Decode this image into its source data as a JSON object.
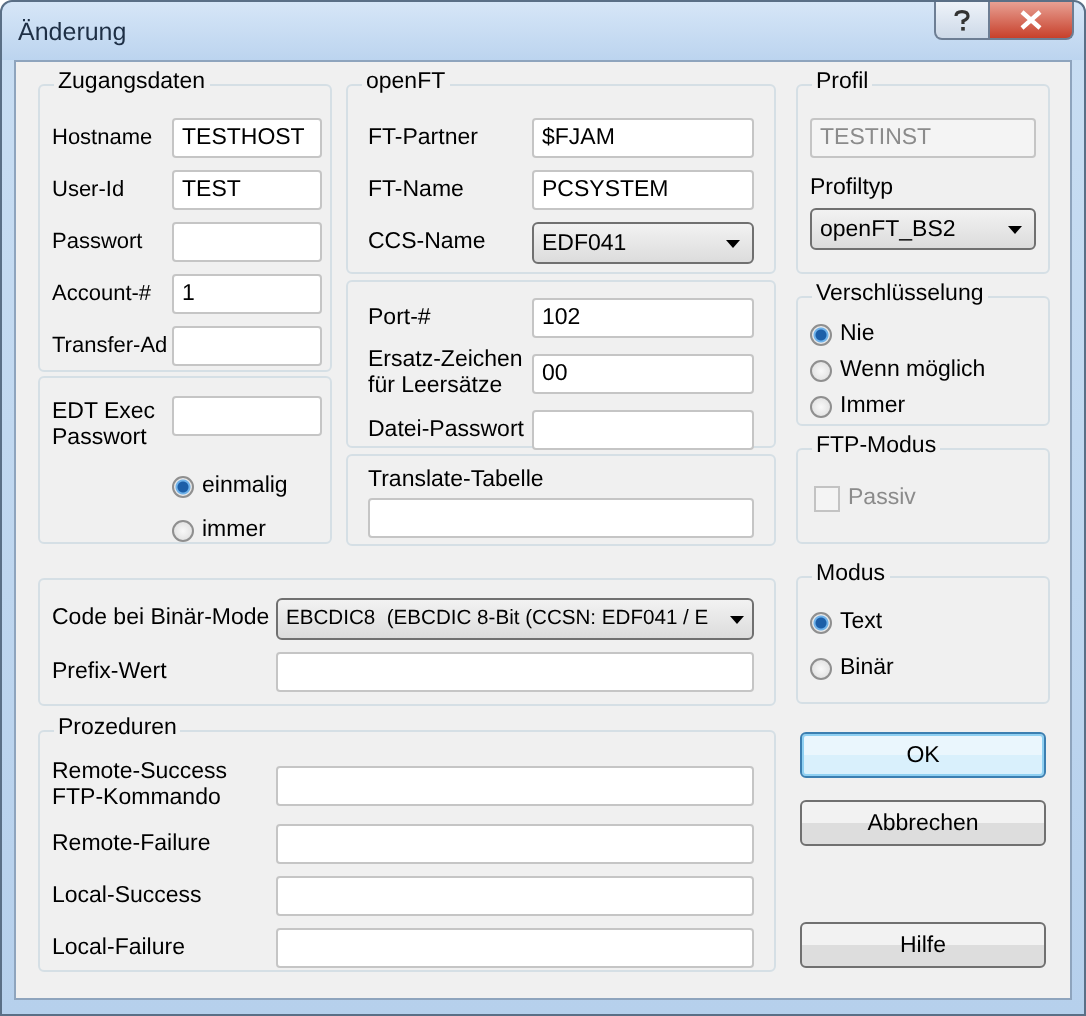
{
  "window": {
    "title": "Änderung"
  },
  "access": {
    "title": "Zugangsdaten",
    "fields": [
      {
        "label": "Hostname",
        "value": "TESTHOST"
      },
      {
        "label": "User-Id",
        "value": "TEST"
      },
      {
        "label": "Passwort"
      },
      {
        "label": "Account-#",
        "value": "1"
      },
      {
        "label": "Transfer-Ad"
      }
    ]
  },
  "edt": {
    "label": "EDT Exec Passwort",
    "options": [
      {
        "label": "einmalig",
        "selected": true
      },
      {
        "label": "immer",
        "selected": false
      }
    ]
  },
  "openft": {
    "title": "openFT",
    "fields": [
      {
        "kind": "text",
        "label": "FT-Partner",
        "value": "$FJAM"
      },
      {
        "kind": "text",
        "label": "FT-Name",
        "value": "PCSYSTEM"
      },
      {
        "kind": "dropdown",
        "label": "CCS-Name",
        "value": "EDF041"
      }
    ]
  },
  "transfer": {
    "fields": [
      {
        "label": "Port-#",
        "value": "102"
      },
      {
        "label": "Ersatz-Zeichen für Leersätze",
        "value": "00"
      },
      {
        "label": "Datei-Passwort"
      }
    ]
  },
  "translate": {
    "label": "Translate-Tabelle"
  },
  "code": {
    "fields": [
      {
        "kind": "dropdown",
        "label": "Code bei Binär-Mode",
        "value": "EBCDIC8  (EBCDIC 8-Bit (CCSN: EDF041 / E"
      },
      {
        "kind": "text",
        "label": "Prefix-Wert"
      }
    ]
  },
  "procedures": {
    "title": "Prozeduren",
    "fields": [
      {
        "label": "Remote-Success FTP-Kommando"
      },
      {
        "label": "Remote-Failure"
      },
      {
        "label": "Local-Success"
      },
      {
        "label": "Local-Failure"
      }
    ]
  },
  "profile": {
    "title": "Profil",
    "name": {
      "value": "TESTINST",
      "disabled": true
    },
    "type_label": "Profiltyp",
    "type": "openFT_BS2"
  },
  "encryption": {
    "title": "Verschlüsselung",
    "options": [
      {
        "label": "Nie",
        "selected": true
      },
      {
        "label": "Wenn möglich",
        "selected": false
      },
      {
        "label": "Immer",
        "selected": false
      }
    ]
  },
  "ftp_mode": {
    "title": "FTP-Modus",
    "passive": {
      "label": "Passiv",
      "checked": false,
      "disabled": true
    }
  },
  "mode": {
    "title": "Modus",
    "options": [
      {
        "label": "Text",
        "selected": true
      },
      {
        "label": "Binär",
        "selected": false
      }
    ]
  },
  "buttons": [
    {
      "label": "OK",
      "default": true
    },
    {
      "label": "Abbrechen",
      "default": false
    },
    {
      "label": "Hilfe",
      "default": false
    }
  ]
}
